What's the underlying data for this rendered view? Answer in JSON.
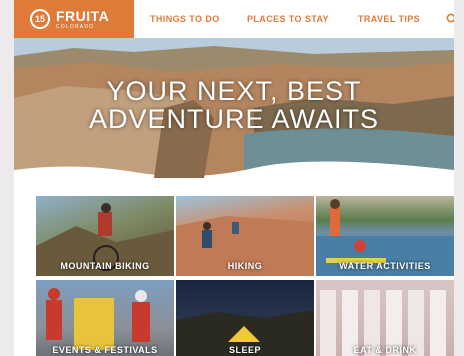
{
  "header": {
    "logo": {
      "name": "FRUITA",
      "sub": "COLORADO",
      "mark": "15"
    },
    "nav": [
      {
        "label": "THINGS TO DO"
      },
      {
        "label": "PLACES TO STAY"
      },
      {
        "label": "TRAVEL TIPS"
      }
    ],
    "search_icon": "search-icon",
    "colors": {
      "brand": "#e07a38"
    }
  },
  "hero": {
    "line1": "YOUR NEXT, BEST",
    "line2": "ADVENTURE AWAITS"
  },
  "tiles": [
    {
      "label": "MOUNTAIN BIKING"
    },
    {
      "label": "HIKING"
    },
    {
      "label": "WATER ACTIVITIES"
    },
    {
      "label": "EVENTS & FESTIVALS"
    },
    {
      "label": "SLEEP"
    },
    {
      "label": "EAT & DRINK"
    }
  ]
}
